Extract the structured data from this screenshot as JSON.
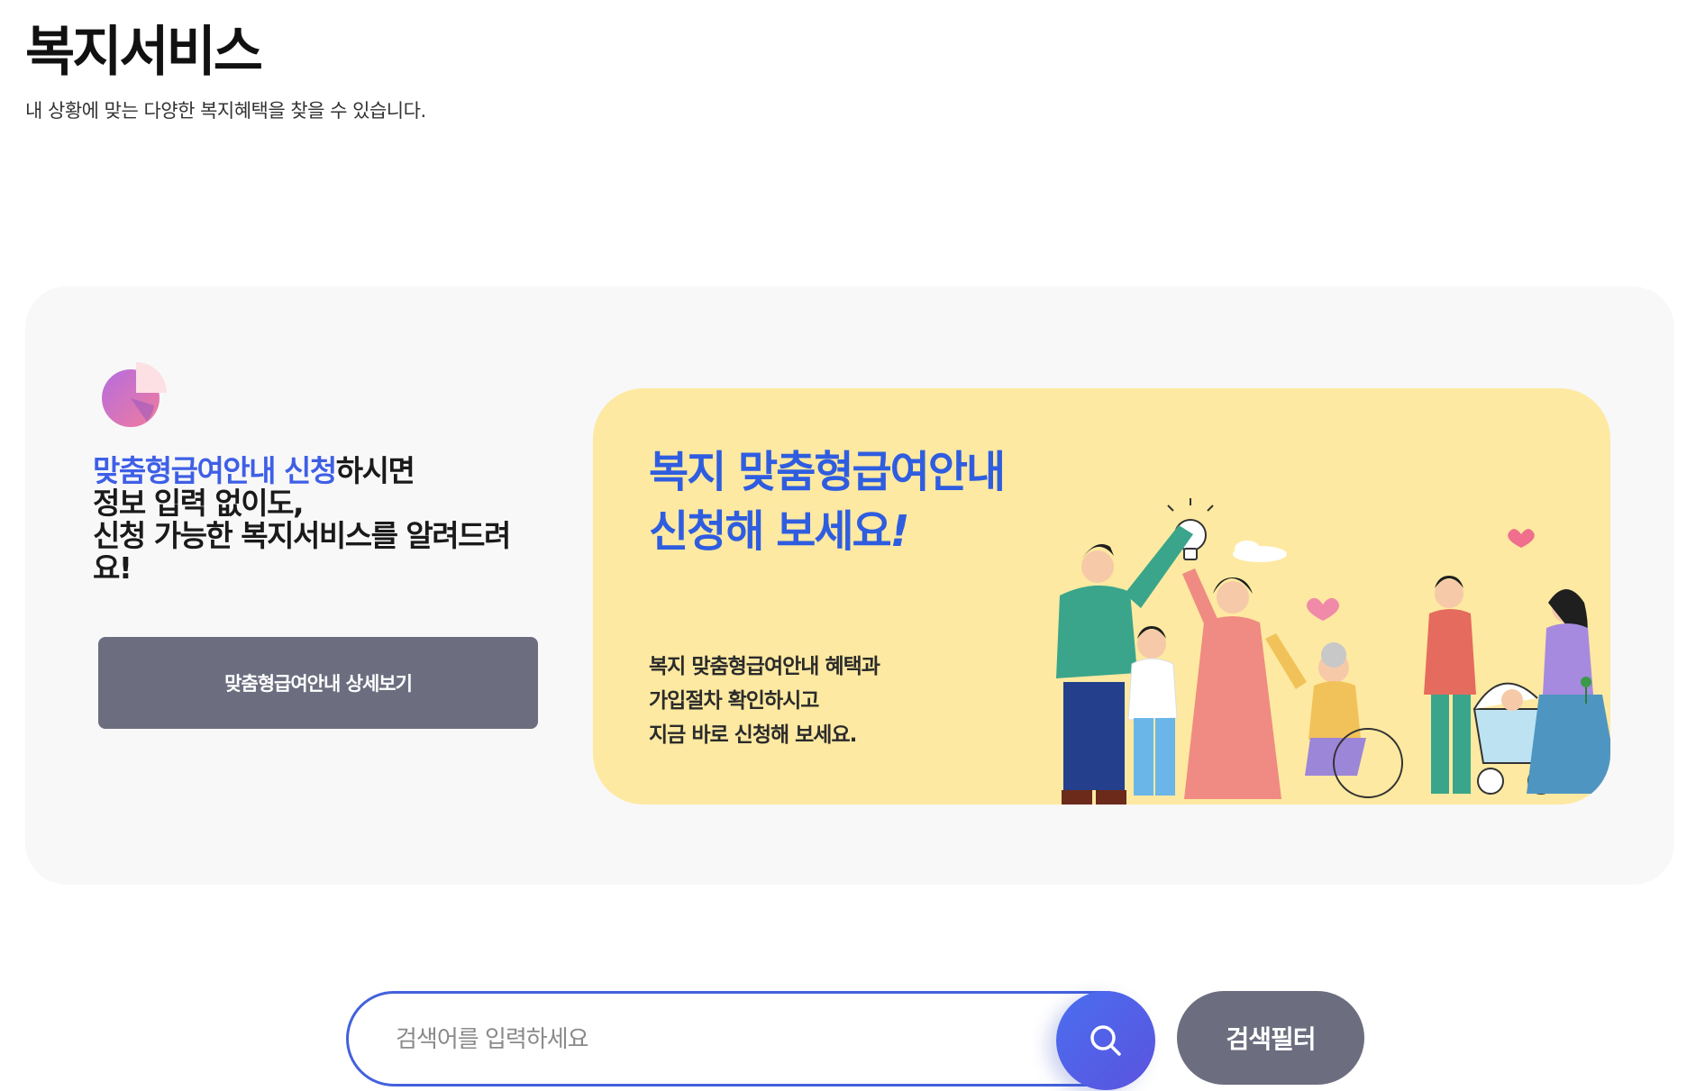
{
  "header": {
    "title": "복지서비스",
    "subtitle": "내 상황에 맞는 다양한 복지혜택을 찾을 수 있습니다."
  },
  "promo": {
    "icon": "pie-chart-icon",
    "highlight": "맞춤형급여안내 신청",
    "line1_rest": "하시면",
    "line2": "정보 입력 없이도,",
    "line3": "신청 가능한 복지서비스를 알려드려",
    "line4": "요!",
    "detail_button_label": "맞춤형급여안내 상세보기"
  },
  "banner": {
    "headline_line1": "복지 맞춤형급여안내",
    "headline_line2": "신청해 보세요",
    "headline_excl": "!",
    "body_line1": "복지 맞춤형급여안내 혜택과",
    "body_line2": "가입절차 확인하시고",
    "body_line3": "지금 바로 신청해 보세요.",
    "illustration": "family-illustration"
  },
  "search": {
    "placeholder": "검색어를 입력하세요",
    "button_icon": "search-icon",
    "filter_label": "검색필터"
  },
  "colors": {
    "accent_blue": "#3e5fe6",
    "button_gray": "#6c6e80",
    "panel_bg": "#f8f8f9",
    "banner_yellow": "#fde9a1"
  }
}
